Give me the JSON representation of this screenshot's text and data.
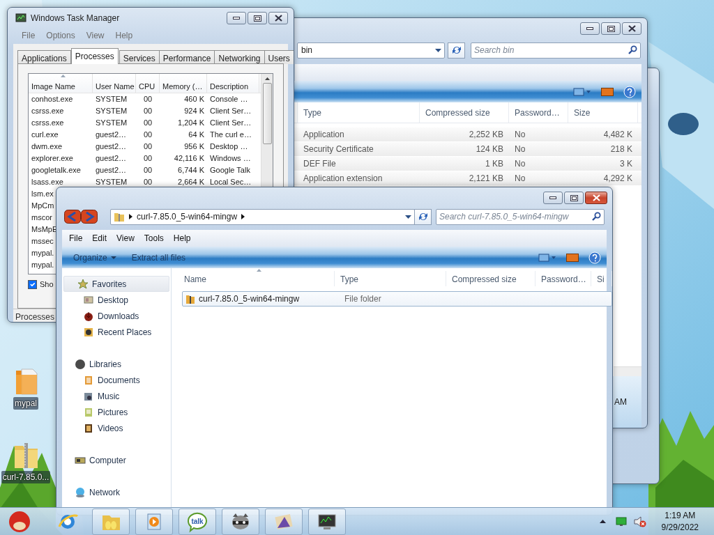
{
  "desktop_icons": [
    {
      "label": "mypal",
      "kind": "folder"
    },
    {
      "label": "curl-7.85.0...",
      "kind": "zip"
    }
  ],
  "task_manager": {
    "title": "Windows Task Manager",
    "menu": [
      "File",
      "Options",
      "View",
      "Help"
    ],
    "tabs": [
      {
        "label": "Applications",
        "selected": false
      },
      {
        "label": "Processes",
        "selected": true
      },
      {
        "label": "Services",
        "selected": false
      },
      {
        "label": "Performance",
        "selected": false
      },
      {
        "label": "Networking",
        "selected": false
      },
      {
        "label": "Users",
        "selected": false
      }
    ],
    "columns": [
      {
        "label": "Image Name",
        "sorted": true
      },
      {
        "label": "User Name",
        "sorted": false
      },
      {
        "label": "CPU",
        "sorted": false
      },
      {
        "label": "Memory (…",
        "sorted": false
      },
      {
        "label": "Description",
        "sorted": false
      }
    ],
    "rows": [
      [
        "conhost.exe",
        "SYSTEM",
        "00",
        "460 K",
        "Console …"
      ],
      [
        "csrss.exe",
        "SYSTEM",
        "00",
        "924 K",
        "Client Ser…"
      ],
      [
        "csrss.exe",
        "SYSTEM",
        "00",
        "1,204 K",
        "Client Ser…"
      ],
      [
        "curl.exe",
        "guest2…",
        "00",
        "64 K",
        "The curl e…"
      ],
      [
        "dwm.exe",
        "guest2…",
        "00",
        "956 K",
        "Desktop …"
      ],
      [
        "explorer.exe",
        "guest2…",
        "00",
        "42,116 K",
        "Windows …"
      ],
      [
        "googletalk.exe",
        "guest2…",
        "00",
        "6,744 K",
        "Google Talk"
      ],
      [
        "lsass.exe",
        "SYSTEM",
        "00",
        "2,664 K",
        "Local Sec…"
      ],
      [
        "lsm.ex"
      ],
      [
        "MpCm"
      ],
      [
        "mscor"
      ],
      [
        "MsMpE"
      ],
      [
        "mssec"
      ],
      [
        "mypal."
      ],
      [
        "mypal."
      ]
    ],
    "show_all": {
      "label": "Sho",
      "checked": true
    },
    "status": "Processes"
  },
  "back_explorer": {
    "address": "bin",
    "search_placeholder": "Search bin",
    "columns": [
      "Type",
      "Compressed size",
      "Password…",
      "Size"
    ],
    "rows": [
      [
        "Application",
        "2,252 KB",
        "No",
        "4,482 K"
      ],
      [
        "Security Certificate",
        "124 KB",
        "No",
        "218 K"
      ],
      [
        "DEF File",
        "1 KB",
        "No",
        "3 K"
      ],
      [
        "Application extension",
        "2,121 KB",
        "No",
        "4,292 K"
      ]
    ],
    "details_text": "AM"
  },
  "front_explorer": {
    "address": "curl-7.85.0_5-win64-mingw",
    "search_placeholder": "Search curl-7.85.0_5-win64-mingw",
    "menu": [
      "File",
      "Edit",
      "View",
      "Tools",
      "Help"
    ],
    "toolbar": [
      {
        "label": "Organize",
        "kind": "dropdown"
      },
      {
        "label": "Extract all files",
        "kind": "plain"
      }
    ],
    "nav": [
      {
        "label": "Favorites",
        "kind": "favorites",
        "hovered": true,
        "children": [
          {
            "label": "Desktop",
            "kind": "desktop"
          },
          {
            "label": "Downloads",
            "kind": "downloads"
          },
          {
            "label": "Recent Places",
            "kind": "recent"
          }
        ]
      },
      {
        "label": "Libraries",
        "kind": "libraries",
        "hovered": false,
        "children": [
          {
            "label": "Documents",
            "kind": "documents"
          },
          {
            "label": "Music",
            "kind": "music"
          },
          {
            "label": "Pictures",
            "kind": "pictures"
          },
          {
            "label": "Videos",
            "kind": "videos"
          }
        ]
      },
      {
        "label": "Computer",
        "kind": "computer",
        "hovered": false
      },
      {
        "label": "Network",
        "kind": "network",
        "hovered": false
      }
    ],
    "columns": [
      {
        "label": "Name",
        "sorted": true
      },
      {
        "label": "Type",
        "sorted": false
      },
      {
        "label": "Compressed size",
        "sorted": false
      },
      {
        "label": "Password…",
        "sorted": false
      },
      {
        "label": "Si",
        "sorted": false
      }
    ],
    "rows": [
      {
        "name": "curl-7.85.0_5-win64-mingw",
        "type": "File folder",
        "selected": true
      }
    ]
  },
  "taskbar": {
    "buttons": [
      {
        "kind": "start",
        "active": false
      },
      {
        "kind": "browser",
        "active": false
      },
      {
        "kind": "folder",
        "active": true
      },
      {
        "kind": "media",
        "active": true
      },
      {
        "kind": "chat",
        "label": "talk",
        "active": true
      },
      {
        "kind": "raccoon",
        "active": true
      },
      {
        "kind": "app",
        "active": true
      },
      {
        "kind": "monitor",
        "active": true
      }
    ],
    "volume_muted": true,
    "clock": {
      "time": "1:19 AM",
      "date": "9/29/2022"
    }
  }
}
